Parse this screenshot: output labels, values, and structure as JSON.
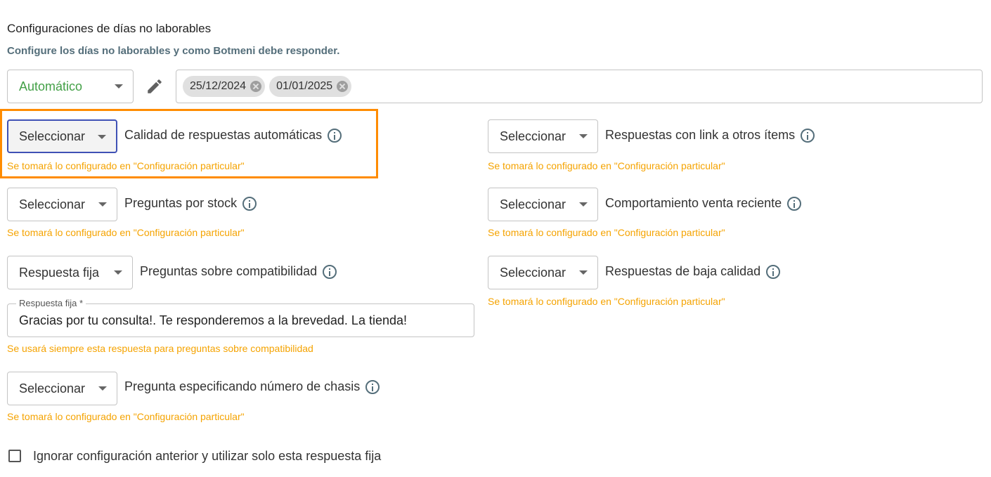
{
  "header": {
    "title": "Configuraciones de días no laborables",
    "subtitle": "Configure los días no laborables y como Botmeni debe responder."
  },
  "nonworking": {
    "mode": "Automático",
    "dates": [
      "25/12/2024",
      "01/01/2025"
    ]
  },
  "settings": {
    "calidad": {
      "select": "Seleccionar",
      "label": "Calidad de respuestas automáticas",
      "hint": "Se tomará lo configurado en \"Configuración particular\""
    },
    "link": {
      "select": "Seleccionar",
      "label": "Respuestas con link a otros ítems",
      "hint": "Se tomará lo configurado en \"Configuración particular\""
    },
    "stock": {
      "select": "Seleccionar",
      "label": "Preguntas por stock",
      "hint": "Se tomará lo configurado en \"Configuración particular\""
    },
    "venta": {
      "select": "Seleccionar",
      "label": "Comportamiento venta reciente",
      "hint": "Se tomará lo configurado en \"Configuración particular\""
    },
    "compat": {
      "select": "Respuesta fija",
      "label": "Preguntas sobre compatibilidad",
      "field_label": "Respuesta fija *",
      "field_value": "Gracias por tu consulta!. Te responderemos a la brevedad. La tienda!",
      "hint": "Se usará siempre esta respuesta para preguntas sobre compatibilidad"
    },
    "baja": {
      "select": "Seleccionar",
      "label": "Respuestas de baja calidad",
      "hint": "Se tomará lo configurado en \"Configuración particular\""
    },
    "chasis": {
      "select": "Seleccionar",
      "label": "Pregunta especificando número de chasis",
      "hint": "Se tomará lo configurado en \"Configuración particular\""
    }
  },
  "checkbox": {
    "label": "Ignorar configuración anterior y utilizar solo esta respuesta fija",
    "checked": false
  },
  "colors": {
    "accent_orange": "#ff8c00",
    "hint": "#f5a300",
    "focus": "#3f51b5",
    "green": "#43a047"
  }
}
